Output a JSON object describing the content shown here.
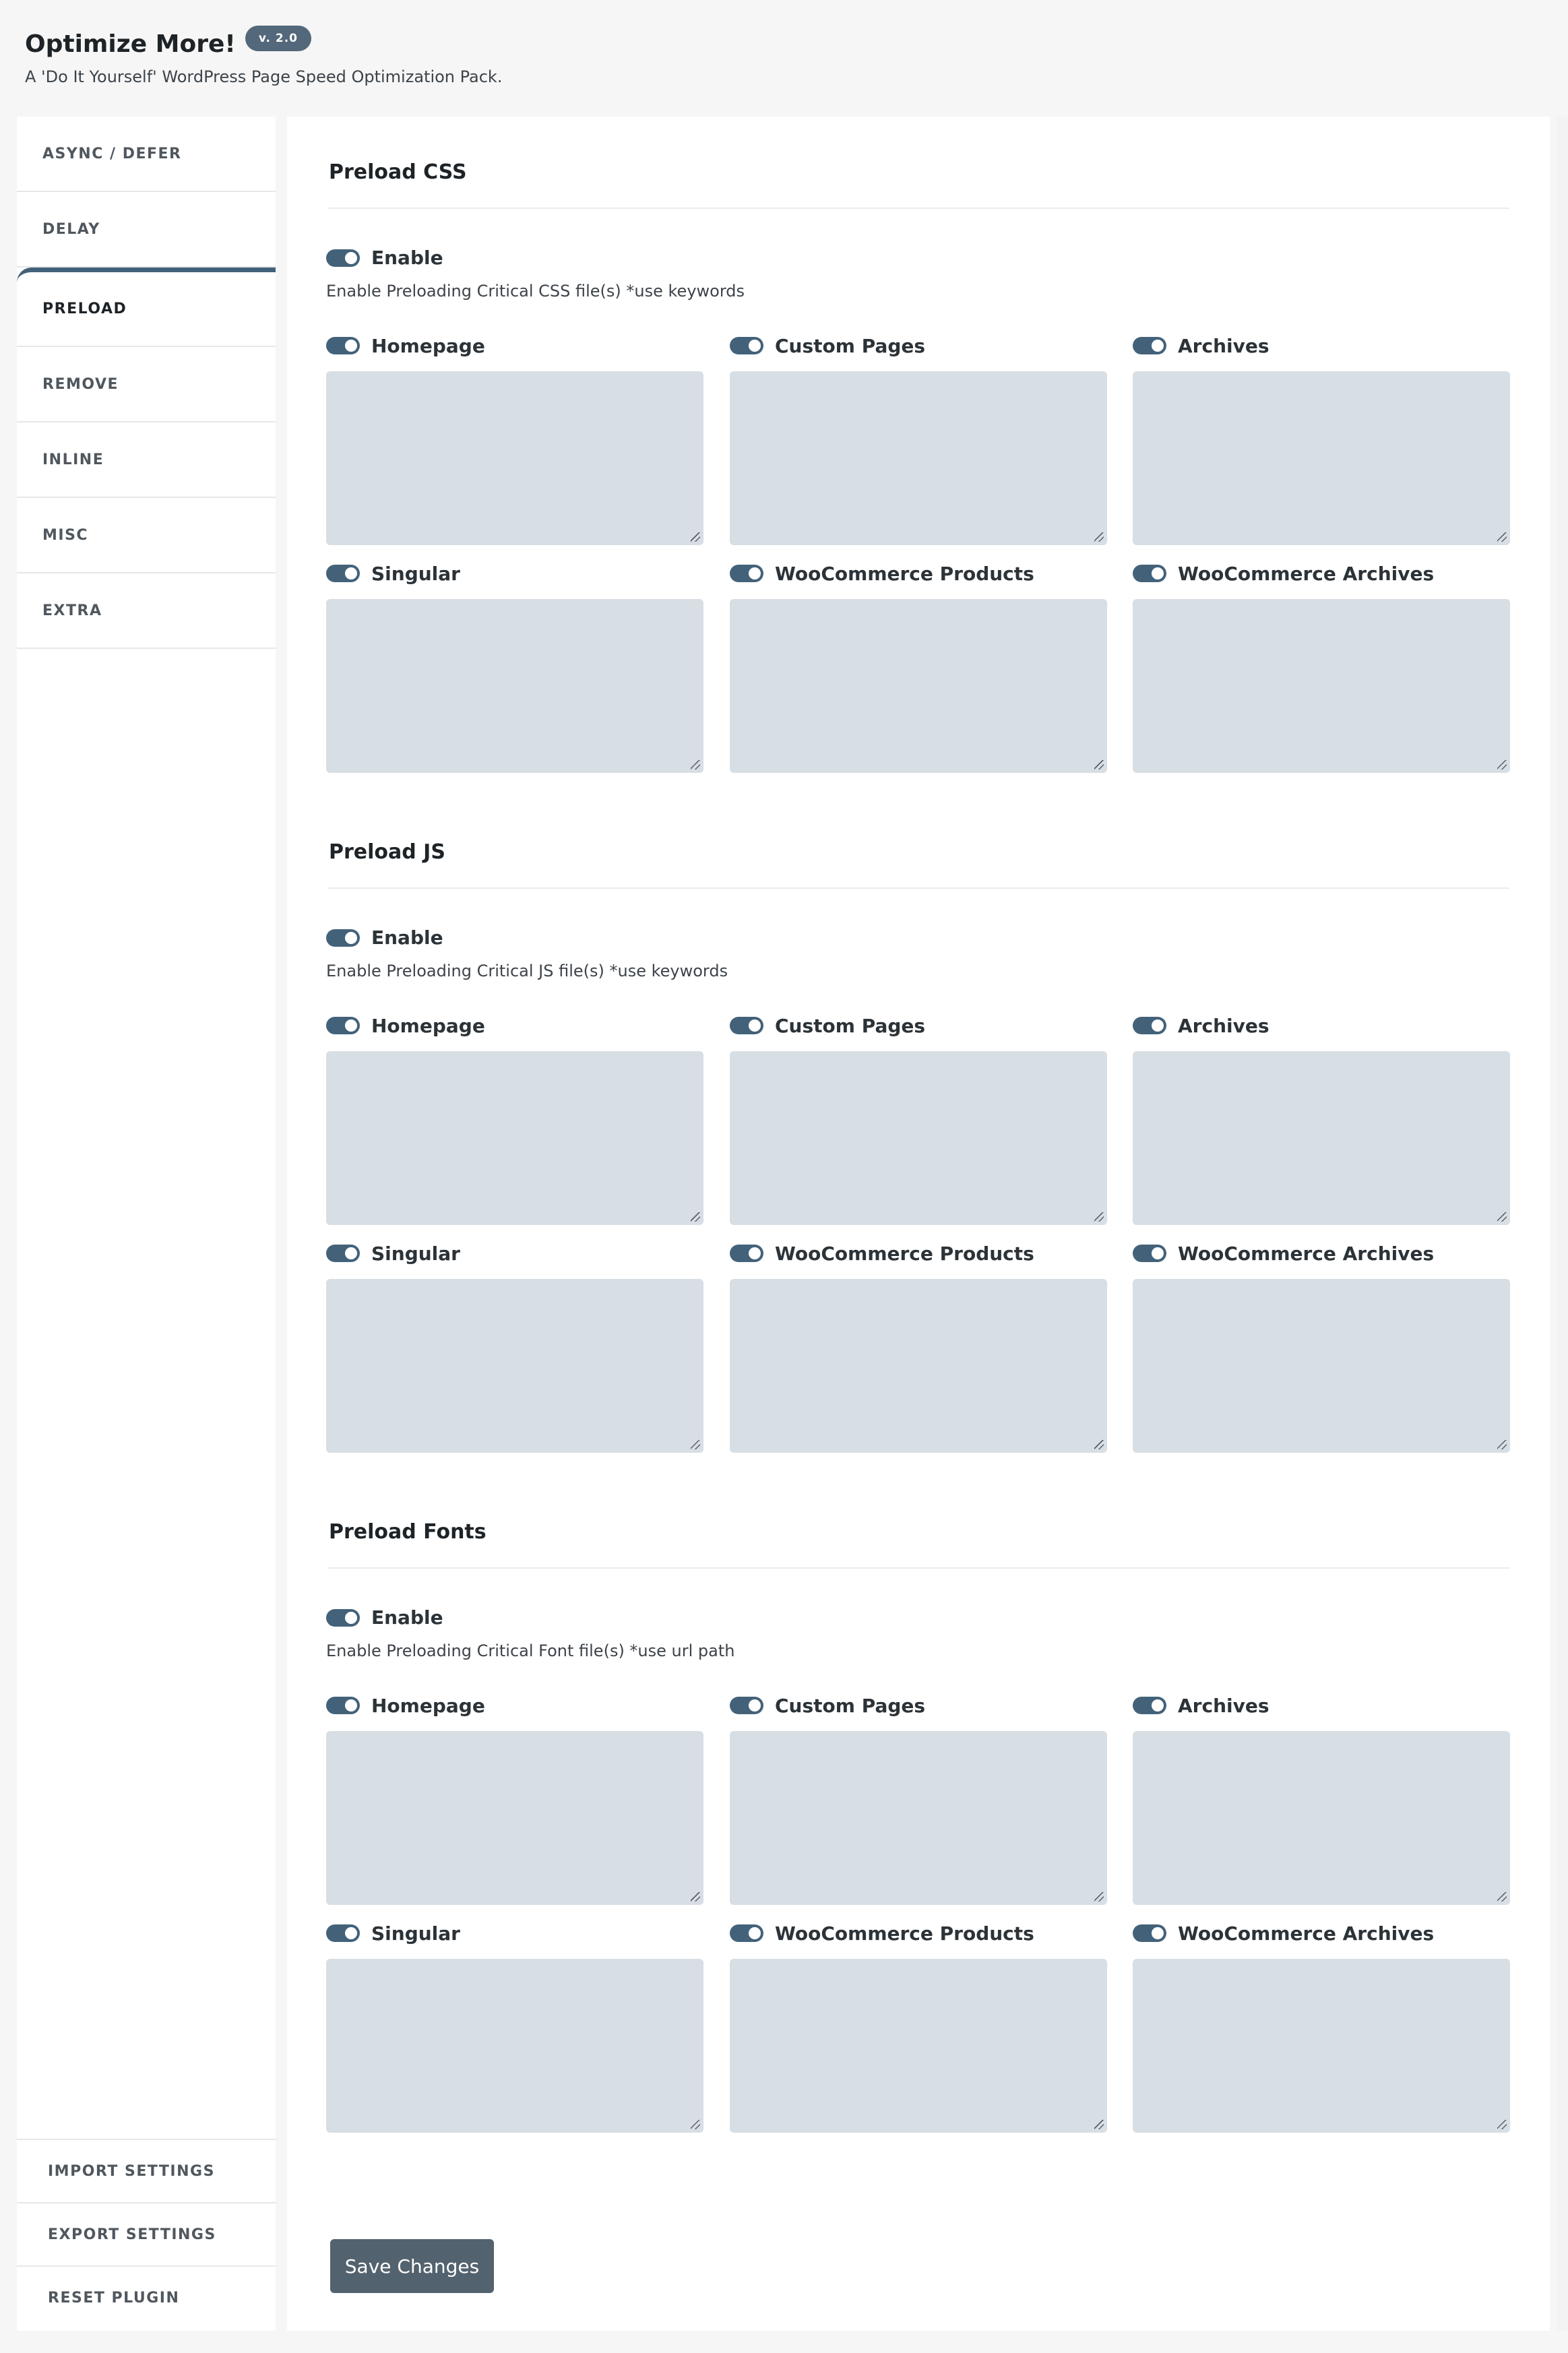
{
  "header": {
    "title": "Optimize More!",
    "version": "v. 2.0",
    "subtitle": "A 'Do It Yourself' WordPress Page Speed Optimization Pack."
  },
  "sidebar": {
    "items": [
      {
        "label": "ASYNC / DEFER"
      },
      {
        "label": "DELAY"
      },
      {
        "label": "PRELOAD",
        "active": true
      },
      {
        "label": "REMOVE"
      },
      {
        "label": "INLINE"
      },
      {
        "label": "MISC"
      },
      {
        "label": "EXTRA"
      }
    ],
    "bottom_items": [
      {
        "label": "IMPORT SETTINGS"
      },
      {
        "label": "EXPORT SETTINGS"
      },
      {
        "label": "RESET PLUGIN"
      }
    ]
  },
  "sections": [
    {
      "title": "Preload CSS",
      "enable_label": "Enable",
      "enabled": true,
      "description": "Enable Preloading Critical CSS file(s) *use keywords",
      "fields": [
        {
          "label": "Homepage",
          "enabled": true,
          "value": ""
        },
        {
          "label": "Custom Pages",
          "enabled": true,
          "value": ""
        },
        {
          "label": "Archives",
          "enabled": true,
          "value": ""
        },
        {
          "label": "Singular",
          "enabled": true,
          "value": ""
        },
        {
          "label": "WooCommerce Products",
          "enabled": true,
          "value": ""
        },
        {
          "label": "WooCommerce Archives",
          "enabled": true,
          "value": ""
        }
      ]
    },
    {
      "title": "Preload JS",
      "enable_label": "Enable",
      "enabled": true,
      "description": "Enable Preloading Critical JS file(s) *use keywords",
      "fields": [
        {
          "label": "Homepage",
          "enabled": true,
          "value": ""
        },
        {
          "label": "Custom Pages",
          "enabled": true,
          "value": ""
        },
        {
          "label": "Archives",
          "enabled": true,
          "value": ""
        },
        {
          "label": "Singular",
          "enabled": true,
          "value": ""
        },
        {
          "label": "WooCommerce Products",
          "enabled": true,
          "value": ""
        },
        {
          "label": "WooCommerce Archives",
          "enabled": true,
          "value": ""
        }
      ]
    },
    {
      "title": "Preload Fonts",
      "enable_label": "Enable",
      "enabled": true,
      "description": "Enable Preloading Critical Font file(s) *use url path",
      "fields": [
        {
          "label": "Homepage",
          "enabled": true,
          "value": ""
        },
        {
          "label": "Custom Pages",
          "enabled": true,
          "value": ""
        },
        {
          "label": "Archives",
          "enabled": true,
          "value": ""
        },
        {
          "label": "Singular",
          "enabled": true,
          "value": ""
        },
        {
          "label": "WooCommerce Products",
          "enabled": true,
          "value": ""
        },
        {
          "label": "WooCommerce Archives",
          "enabled": true,
          "value": ""
        }
      ]
    }
  ],
  "actions": {
    "save_label": "Save Changes"
  },
  "colors": {
    "accent": "#43627a",
    "badge": "#53687a",
    "button": "#53626f",
    "textarea_bg": "#d7dee4",
    "page_bg": "#f6f6f6"
  }
}
